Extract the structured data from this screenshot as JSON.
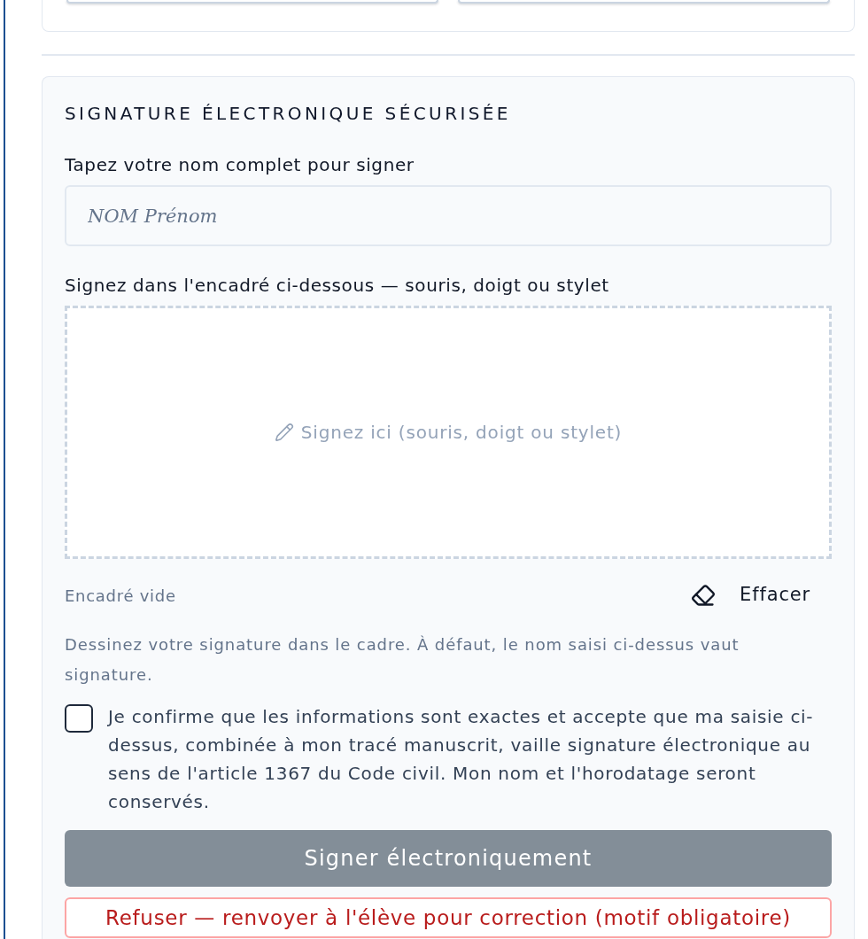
{
  "signature": {
    "title": "SIGNATURE ÉLECTRONIQUE SÉCURISÉE",
    "name_field": {
      "label": "Tapez votre nom complet pour signer",
      "placeholder": "NOM Prénom"
    },
    "pad": {
      "label": "Signez dans l'encadré ci-dessous — souris, doigt ou stylet",
      "hint": "Signez ici (souris, doigt ou stylet)",
      "status": "Encadré vide",
      "clear_button": "Effacer"
    },
    "help": "Dessinez votre signature dans le cadre. À défaut, le nom saisi ci-dessus vaut signature.",
    "consent": {
      "checked": false,
      "text": "Je confirme que les informations sont exactes et accepte que ma saisie ci-dessus, combinée à mon tracé manuscrit, vaille signature électronique au sens de l'article 1367 du Code civil. Mon nom et l'horodatage seront conservés."
    },
    "buttons": [
      {
        "kind": "primary",
        "label": "Signer électroniquement",
        "disabled": true
      },
      {
        "kind": "danger",
        "label": "Refuser — renvoyer à l'élève pour correction (motif obligatoire)",
        "disabled": false
      }
    ]
  }
}
